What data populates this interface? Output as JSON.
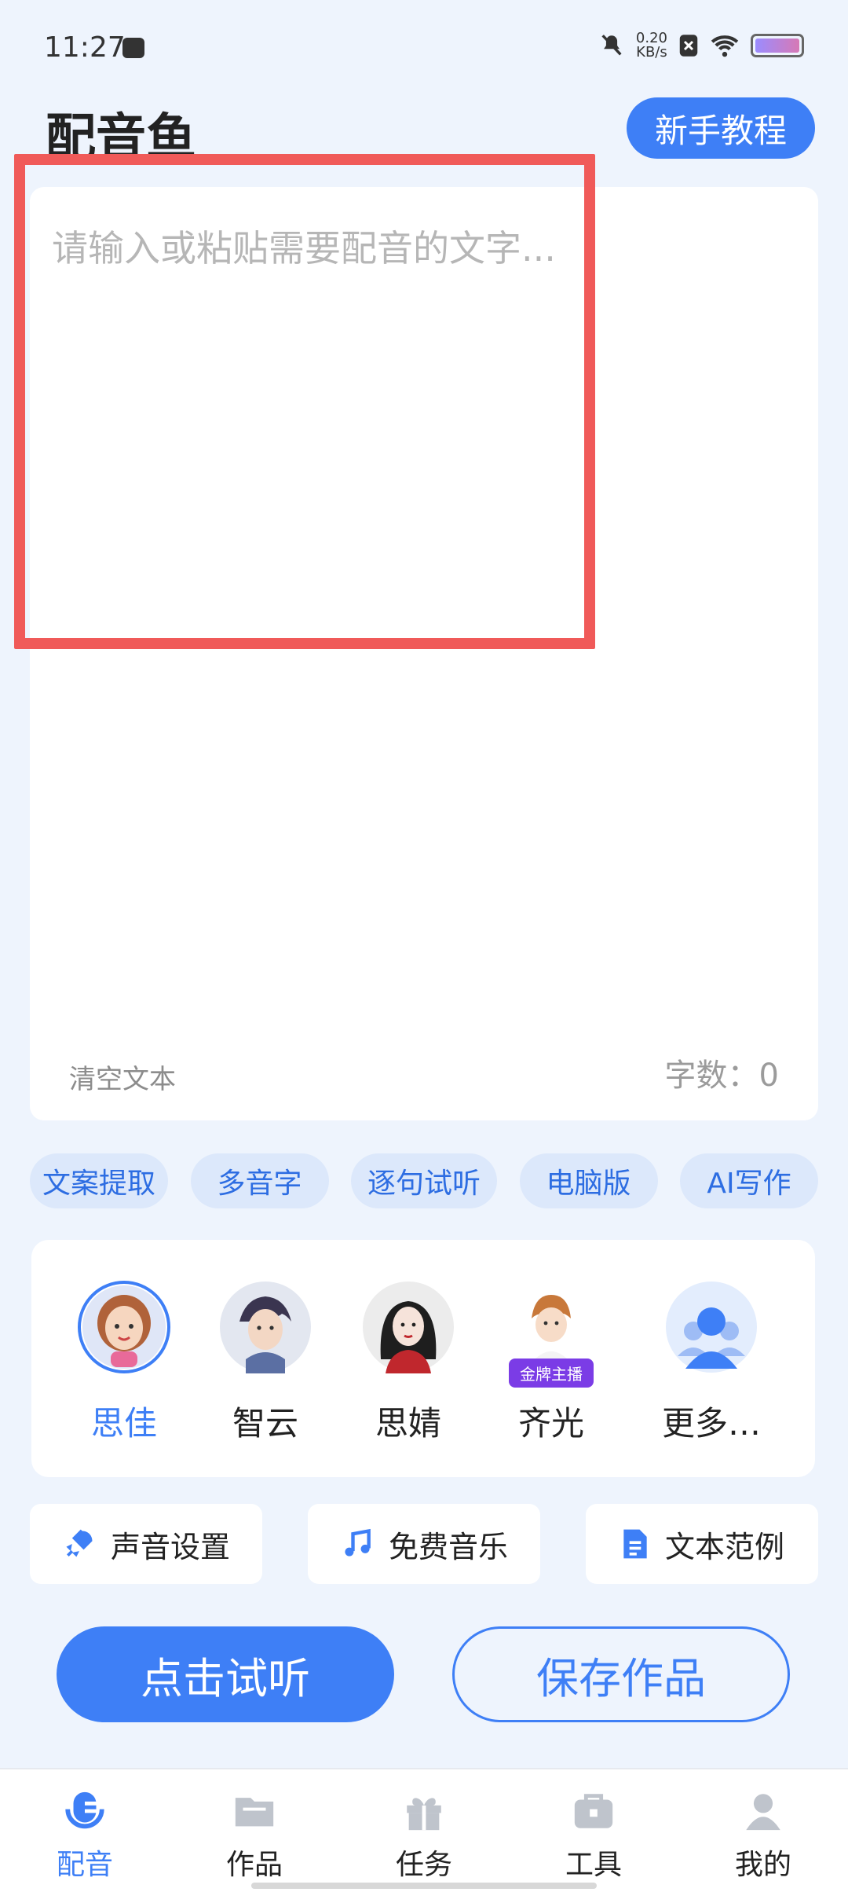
{
  "status_bar": {
    "time": "11:27",
    "net_speed_value": "0.20",
    "net_speed_unit": "KB/s"
  },
  "header": {
    "title": "配音鱼",
    "tutorial_button": "新手教程"
  },
  "editor": {
    "placeholder": "请输入或粘贴需要配音的文字...",
    "clear_label": "清空文本",
    "word_count": "字数：0"
  },
  "pills": [
    "文案提取",
    "多音字",
    "逐句试听",
    "电脑版",
    "AI写作"
  ],
  "voices": [
    {
      "name": "思佳",
      "selected": true
    },
    {
      "name": "智云",
      "selected": false
    },
    {
      "name": "思婧",
      "selected": false
    },
    {
      "name": "齐光",
      "selected": false,
      "badge": "金牌主播"
    },
    {
      "name": "更多…",
      "selected": false
    }
  ],
  "tools": [
    "声音设置",
    "免费音乐",
    "文本范例"
  ],
  "actions": {
    "listen": "点击试听",
    "save": "保存作品"
  },
  "nav": [
    "配音",
    "作品",
    "任务",
    "工具",
    "我的"
  ],
  "colors": {
    "accent": "#3e7ff6",
    "highlight": "#f05a59",
    "badge": "#7b3ce6"
  }
}
